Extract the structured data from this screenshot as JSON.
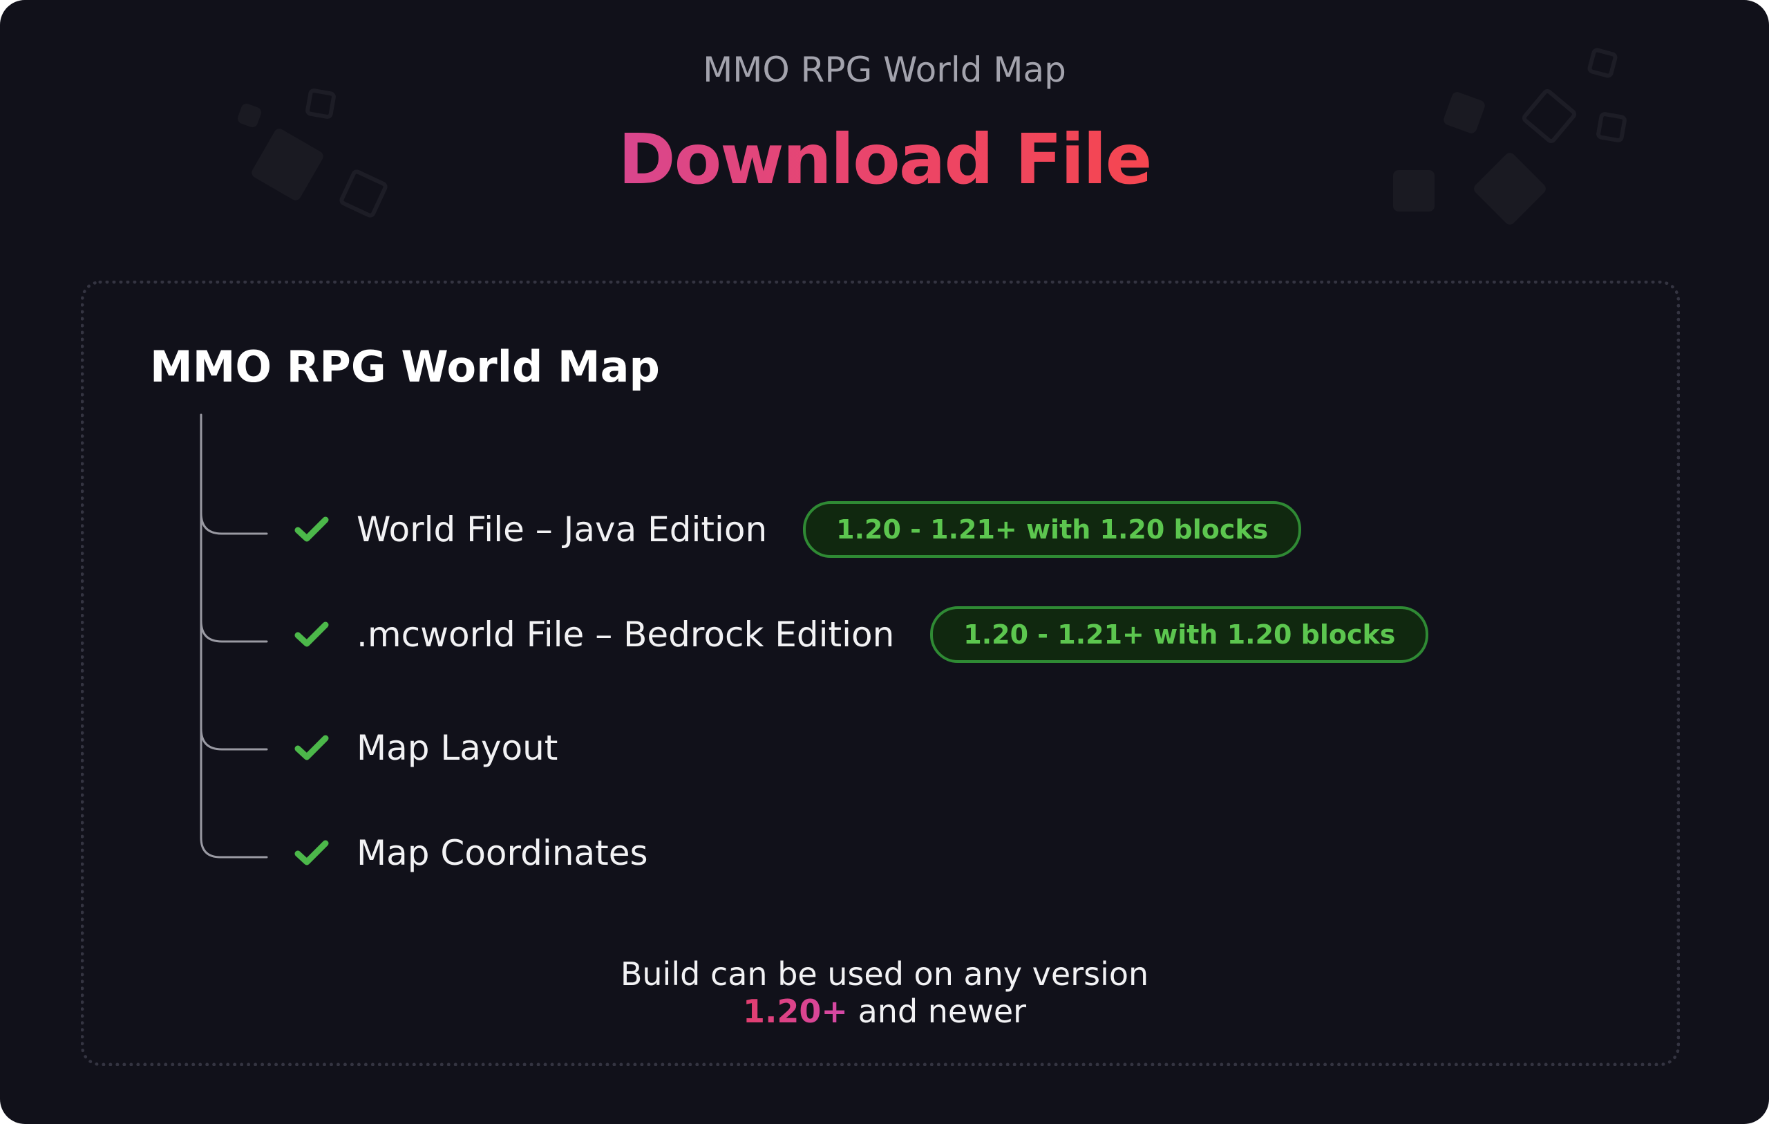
{
  "header": {
    "subtitle": "MMO RPG World Map",
    "title": "Download File"
  },
  "box": {
    "title": "MMO RPG World Map",
    "items": [
      {
        "label": "World File – Java Edition",
        "badge": "1.20 - 1.21+ with 1.20 blocks",
        "icon": "check-icon"
      },
      {
        "label": ".mcworld File – Bedrock Edition",
        "badge": "1.20 - 1.21+ with 1.20 blocks",
        "icon": "check-icon"
      },
      {
        "label": "Map Layout",
        "icon": "check-icon"
      },
      {
        "label": "Map Coordinates",
        "icon": "check-icon"
      }
    ]
  },
  "footer": {
    "line1": "Build can be used on any version",
    "version": "1.20+",
    "line2_suffix": " and newer"
  },
  "colors": {
    "background": "#11111a",
    "accent_gradient_start": "#d9468e",
    "accent_gradient_end": "#f54650",
    "check_green": "#4cb84a",
    "badge_text": "#5cc64f",
    "badge_border": "#2f8a34",
    "badge_bg": "#10280f"
  }
}
